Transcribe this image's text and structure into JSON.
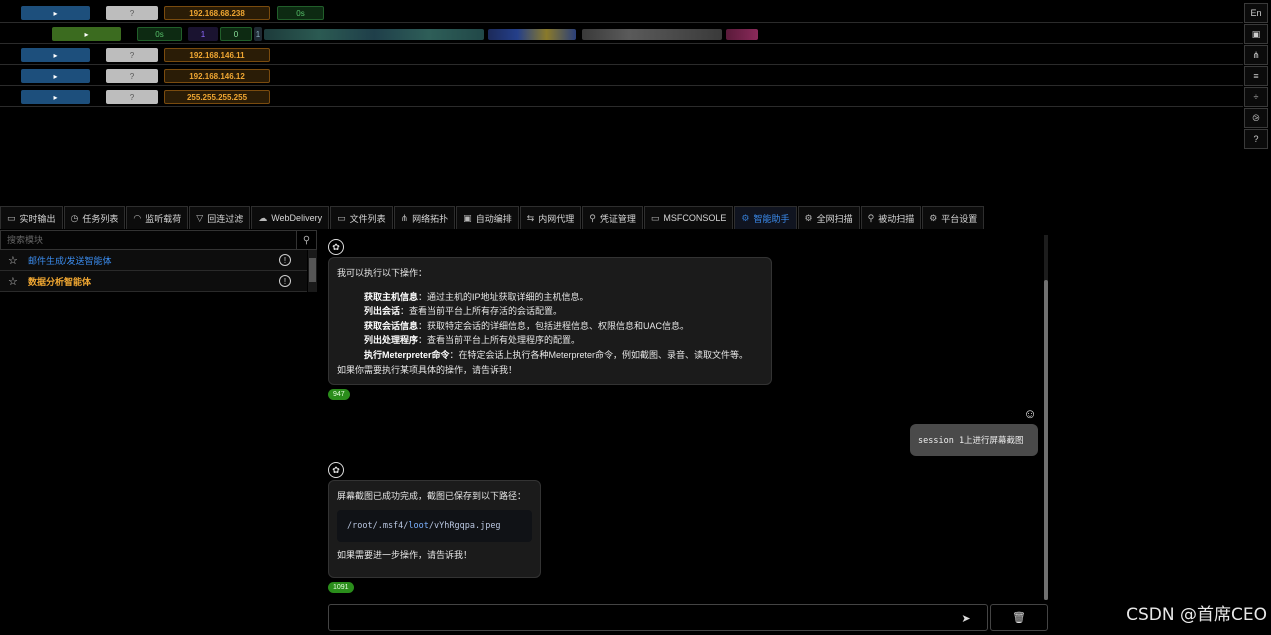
{
  "hosts": [
    {
      "play": "▸",
      "q": "?",
      "ip": "192.168.68.238",
      "extra": "0s"
    },
    {
      "play": "▸",
      "c1": "0s",
      "c2": "1",
      "c3": "0",
      "c4": "1"
    },
    {
      "play": "▸",
      "q": "?",
      "ip": "192.168.146.11"
    },
    {
      "play": "▸",
      "q": "?",
      "ip": "192.168.146.12"
    },
    {
      "play": "▸",
      "q": "?",
      "ip": "255.255.255.255"
    }
  ],
  "right_tools": {
    "lang": "En",
    "icons": [
      "terminal-icon",
      "topology-icon",
      "list-icon",
      "split-icon",
      "compass-icon",
      "help-icon"
    ]
  },
  "tabs": [
    {
      "label": "实时输出",
      "icon": "▭"
    },
    {
      "label": "任务列表",
      "icon": "◷"
    },
    {
      "label": "监听载荷",
      "icon": "◠"
    },
    {
      "label": "回连过滤",
      "icon": "▽"
    },
    {
      "label": "WebDelivery",
      "icon": "☁"
    },
    {
      "label": "文件列表",
      "icon": "▭"
    },
    {
      "label": "网络拓扑",
      "icon": "⋔"
    },
    {
      "label": "自动编排",
      "icon": "▣"
    },
    {
      "label": "内网代理",
      "icon": "⇆"
    },
    {
      "label": "凭证管理",
      "icon": "⚲"
    },
    {
      "label": "MSFCONSOLE",
      "icon": "▭"
    },
    {
      "label": "智能助手",
      "icon": "⚙",
      "active": true
    },
    {
      "label": "全网扫描",
      "icon": "⚙"
    },
    {
      "label": "被动扫描",
      "icon": "⚲"
    },
    {
      "label": "平台设置",
      "icon": "⚙"
    }
  ],
  "left_panel": {
    "search_placeholder": "搜索模块",
    "agents": [
      {
        "name": "邮件生成/发送智能体"
      },
      {
        "name": "数据分析智能体"
      }
    ]
  },
  "chat": {
    "msg1": {
      "intro": "我可以执行以下操作：",
      "items": [
        {
          "title": "获取主机信息",
          "desc": "：通过主机的IP地址获取详细的主机信息。"
        },
        {
          "title": "列出会话",
          "desc": "：查看当前平台上所有存活的会话配置。"
        },
        {
          "title": "获取会话信息",
          "desc": "：获取特定会话的详细信息，包括进程信息、权限信息和UAC信息。"
        },
        {
          "title": "列出处理程序",
          "desc": "：查看当前平台上所有处理程序的配置。"
        },
        {
          "title": "执行Meterpreter命令",
          "desc": "：在特定会话上执行各种Meterpreter命令，例如截图、录音、读取文件等。"
        }
      ],
      "outro": "如果你需要执行某项具体的操作，请告诉我！",
      "tokens": "947"
    },
    "user_msg": "session 1上进行屏幕截图",
    "msg2": {
      "line1": "屏幕截图已成功完成，截图已保存到以下路径：",
      "path_a": "/root/.msf4/",
      "path_b": "loot",
      "path_c": "/vYhRgqpa.jpeg",
      "line2": "如果需要进一步操作，请告诉我！",
      "tokens": "1091"
    }
  },
  "watermark": "CSDN @首席CEO",
  "colors": {
    "accent": "#3b8df0",
    "ip": "#f0a732",
    "token": "#2a8d1b"
  }
}
